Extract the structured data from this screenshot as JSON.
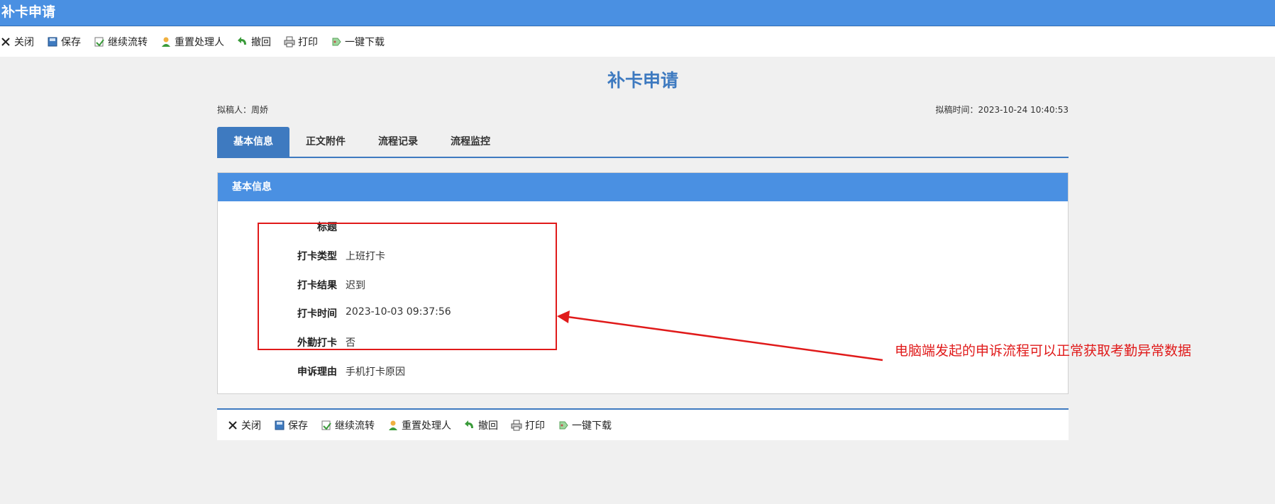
{
  "window": {
    "title": "补卡申请"
  },
  "toolbar": [
    {
      "id": "close",
      "label": "关闭",
      "icon": "close-icon"
    },
    {
      "id": "save",
      "label": "保存",
      "icon": "save-icon"
    },
    {
      "id": "continue",
      "label": "继续流转",
      "icon": "continue-flow-icon"
    },
    {
      "id": "reassign",
      "label": "重置处理人",
      "icon": "reassign-user-icon"
    },
    {
      "id": "withdraw",
      "label": "撤回",
      "icon": "withdraw-icon"
    },
    {
      "id": "print",
      "label": "打印",
      "icon": "print-icon"
    },
    {
      "id": "download",
      "label": "一键下载",
      "icon": "download-icon"
    }
  ],
  "document": {
    "title": "补卡申请",
    "drafter": "拟稿人：周娇",
    "draft_time": "拟稿时间：2023-10-24 10:40:53"
  },
  "tabs": [
    {
      "label": "基本信息",
      "active": true
    },
    {
      "label": "正文附件",
      "active": false
    },
    {
      "label": "流程记录",
      "active": false
    },
    {
      "label": "流程监控",
      "active": false
    }
  ],
  "panel": {
    "header": "基本信息",
    "fields": [
      {
        "label": "标题",
        "value": ""
      },
      {
        "label": "打卡类型",
        "value": "上班打卡"
      },
      {
        "label": "打卡结果",
        "value": "迟到"
      },
      {
        "label": "打卡时间",
        "value": "2023-10-03 09:37:56"
      },
      {
        "label": "外勤打卡",
        "value": "否"
      },
      {
        "label": "申诉理由",
        "value": "手机打卡原因"
      }
    ]
  },
  "annotation": {
    "text": "电脑端发起的申诉流程可以正常获取考勤异常数据",
    "color": "#e01a1a"
  },
  "colors": {
    "accent": "#4a90e2",
    "tab_active": "#3e7ac0",
    "title": "#3e7ac0"
  }
}
